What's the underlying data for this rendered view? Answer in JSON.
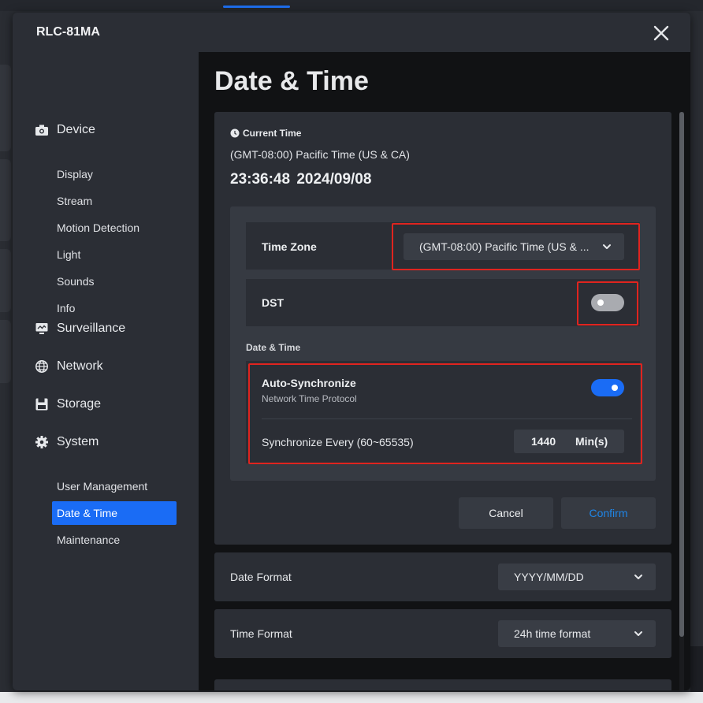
{
  "window": {
    "title": "RLC-81MA"
  },
  "sidebar": {
    "groups": [
      {
        "label": "Device",
        "icon": "camera-icon"
      },
      {
        "label": "Surveillance",
        "icon": "monitor-icon"
      },
      {
        "label": "Network",
        "icon": "globe-icon"
      },
      {
        "label": "Storage",
        "icon": "save-icon"
      },
      {
        "label": "System",
        "icon": "gear-icon"
      }
    ],
    "device_items": [
      "Display",
      "Stream",
      "Motion Detection",
      "Light",
      "Sounds",
      "Info"
    ],
    "system_items": [
      "User Management",
      "Date & Time",
      "Maintenance"
    ],
    "active_item": "Date & Time"
  },
  "page": {
    "title": "Date & Time",
    "current_time": {
      "label": "Current Time",
      "zone": "(GMT-08:00) Pacific Time (US & CA)",
      "time": "23:36:48",
      "date": "2024/09/08"
    },
    "time_zone": {
      "label": "Time Zone",
      "value": "(GMT-08:00) Pacific Time (US & ..."
    },
    "dst": {
      "label": "DST",
      "enabled": false
    },
    "date_time_section": "Date & Time",
    "auto_sync": {
      "title": "Auto-Synchronize",
      "subtitle": "Network Time Protocol",
      "enabled": true,
      "every_label": "Synchronize Every (60~65535)",
      "value": "1440",
      "unit": "Min(s)"
    },
    "buttons": {
      "cancel": "Cancel",
      "confirm": "Confirm"
    },
    "date_format": {
      "label": "Date Format",
      "value": "YYYY/MM/DD"
    },
    "time_format": {
      "label": "Time Format",
      "value": "24h time format"
    }
  },
  "colors": {
    "accent": "#1a6cf5",
    "highlight_border": "#e0241f",
    "confirm_text": "#1f86e8"
  }
}
